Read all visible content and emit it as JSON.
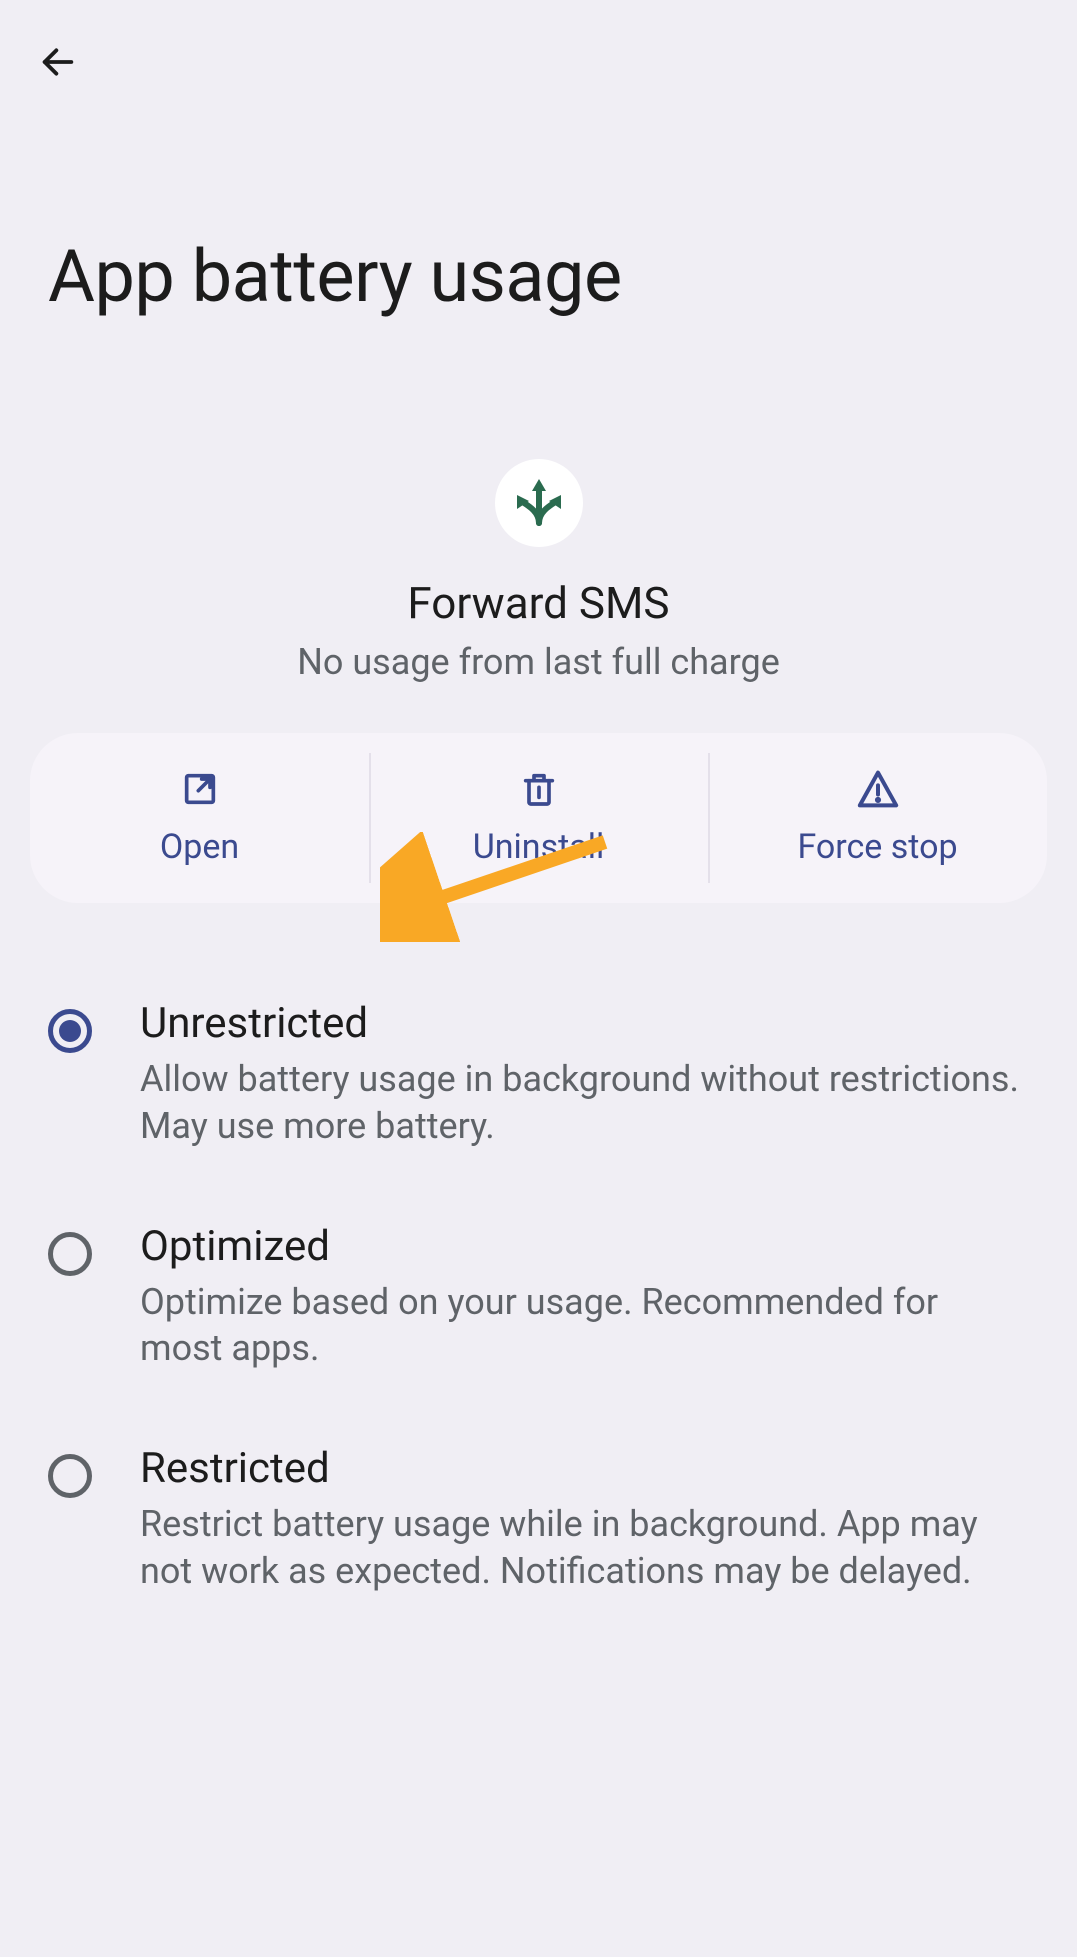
{
  "header": {
    "title": "App battery usage"
  },
  "app": {
    "name": "Forward SMS",
    "subtitle": "No usage from last full charge"
  },
  "actions": {
    "open": "Open",
    "uninstall": "Uninstall",
    "force_stop": "Force stop"
  },
  "options": [
    {
      "title": "Unrestricted",
      "desc": "Allow battery usage in background without restrictions. May use more battery.",
      "selected": true
    },
    {
      "title": "Optimized",
      "desc": "Optimize based on your usage. Recommended for most apps.",
      "selected": false
    },
    {
      "title": "Restricted",
      "desc": "Restrict battery usage while in background. App may not work as expected. Notifications may be delayed.",
      "selected": false
    }
  ],
  "colors": {
    "accent": "#3b4a8f",
    "annotation": "#f9a825"
  }
}
